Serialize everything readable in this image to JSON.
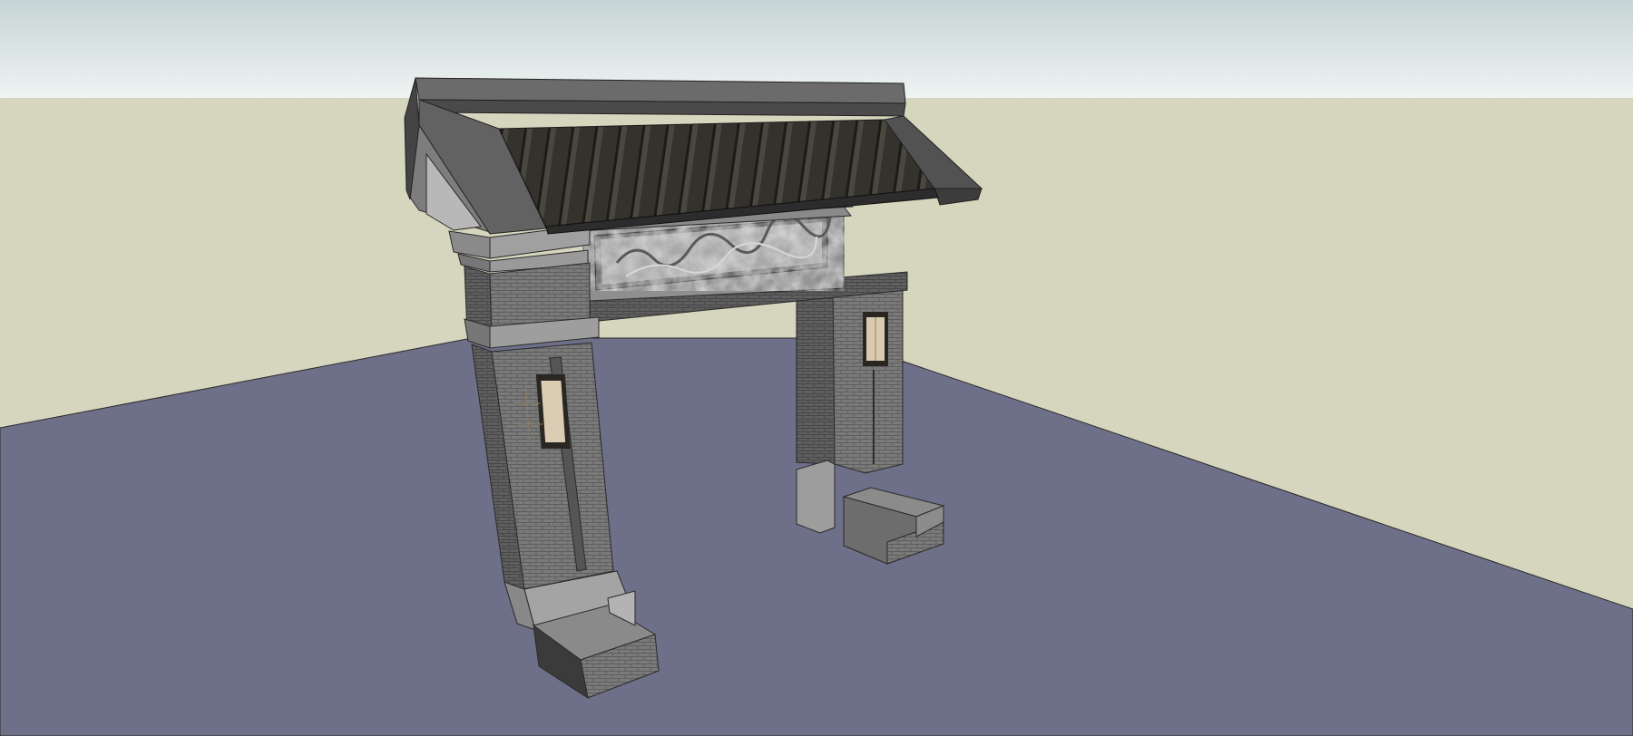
{
  "viewport": {
    "scene": "gate-model",
    "colors": {
      "sky_top": "#c9d5d6",
      "sky_bottom": "#eef3f2",
      "background": "#d6d5bd",
      "ground": "#6f7088",
      "roof_dark": "#2f2d28",
      "roof_edge": "#555555",
      "stone": "#9a9a9a",
      "brick": "#7c7c7c",
      "relief": "#a7a7a7",
      "lamp_glow": "#d8c9ad"
    }
  }
}
